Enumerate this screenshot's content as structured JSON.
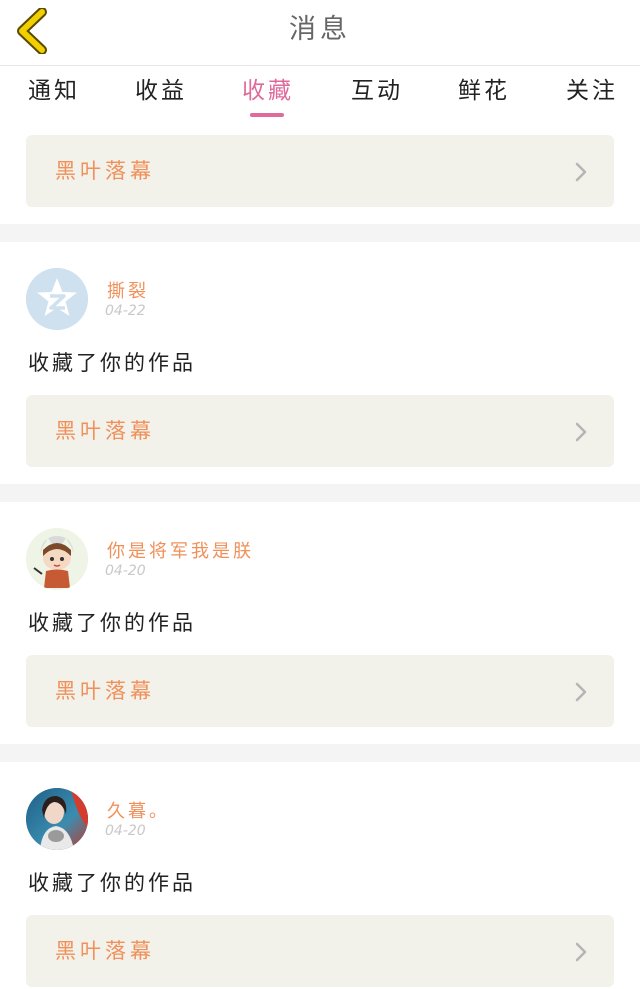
{
  "header": {
    "title": "消息",
    "back_icon": "chevron-left-icon",
    "back_color": "#f2d000"
  },
  "tabs": [
    {
      "label": "通知"
    },
    {
      "label": "收益"
    },
    {
      "label": "收藏",
      "active": true
    },
    {
      "label": "互动"
    },
    {
      "label": "鲜花"
    },
    {
      "label": "关注"
    }
  ],
  "colors": {
    "accent": "#e06a9a",
    "work_title": "#f0905a",
    "card_bg": "#f3f2ea"
  },
  "top_card": {
    "work_title": "黑叶落幕"
  },
  "items": [
    {
      "user": "撕裂",
      "date": "04-22",
      "message": "收藏了你的作品",
      "work_title": "黑叶落幕",
      "avatar": "qzone-star-avatar"
    },
    {
      "user": "你是将军我是朕",
      "date": "04-20",
      "message": "收藏了你的作品",
      "work_title": "黑叶落幕",
      "avatar": "cartoon-girl-avatar"
    },
    {
      "user": "久暮。",
      "date": "04-20",
      "message": "收藏了你的作品",
      "work_title": "黑叶落幕",
      "avatar": "photo-girl-avatar"
    }
  ]
}
